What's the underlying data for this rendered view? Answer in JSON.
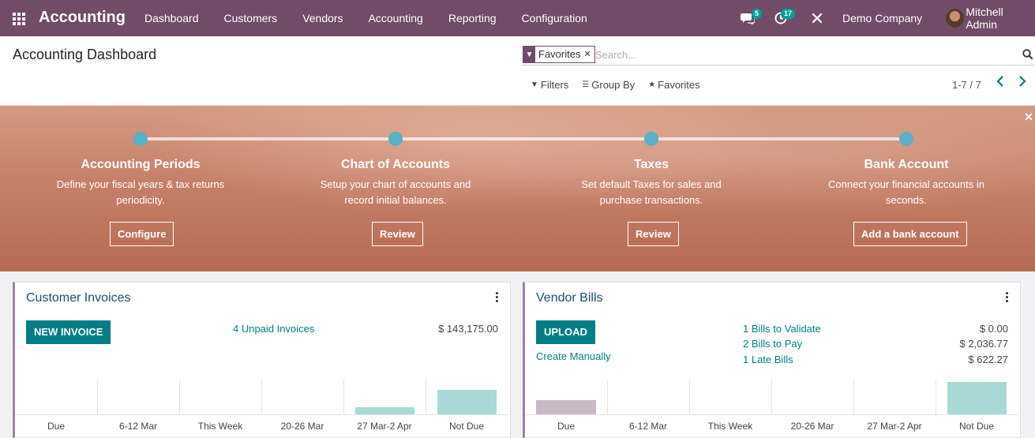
{
  "navbar": {
    "brand": "Accounting",
    "menu": [
      "Dashboard",
      "Customers",
      "Vendors",
      "Accounting",
      "Reporting",
      "Configuration"
    ],
    "messages_count": "5",
    "activities_count": "17",
    "company": "Demo Company",
    "user": "Mitchell Admin",
    "color": "#714b67"
  },
  "control_panel": {
    "title": "Accounting Dashboard",
    "facet_label": "Favorites",
    "search_placeholder": "Search...",
    "filters_label": "Filters",
    "groupby_label": "Group By",
    "favorites_label": "Favorites",
    "pager": "1-7 / 7"
  },
  "onboarding": {
    "steps": [
      {
        "title": "Accounting Periods",
        "desc1": "Define your fiscal years & tax returns",
        "desc2": "periodicity.",
        "button": "Configure"
      },
      {
        "title": "Chart of Accounts",
        "desc1": "Setup your chart of accounts and",
        "desc2": "record initial balances.",
        "button": "Review"
      },
      {
        "title": "Taxes",
        "desc1": "Set default Taxes for sales and",
        "desc2": "purchase transactions.",
        "button": "Review"
      },
      {
        "title": "Bank Account",
        "desc1": "Connect your financial accounts in",
        "desc2": "seconds.",
        "button": "Add a bank account"
      }
    ]
  },
  "customer_invoices": {
    "title": "Customer Invoices",
    "button": "NEW INVOICE",
    "unpaid_link": "4 Unpaid Invoices",
    "unpaid_amount": "$ 143,175.00",
    "graph_labels": [
      "Due",
      "6-12 Mar",
      "This Week",
      "20-26 Mar",
      "27 Mar-2 Apr",
      "Not Due"
    ],
    "graph_values": [
      0,
      0,
      0,
      0,
      0.22,
      0.7
    ],
    "bar_color": "#a8d9d6"
  },
  "vendor_bills": {
    "title": "Vendor Bills",
    "button": "UPLOAD",
    "create_manually": "Create Manually",
    "rows": [
      {
        "label": "1 Bills to Validate",
        "amount": "$ 0.00"
      },
      {
        "label": "2 Bills to Pay",
        "amount": "$ 2,036.77"
      },
      {
        "label": "1 Late Bills",
        "amount": "$ 622.27"
      }
    ],
    "graph_labels": [
      "Due",
      "6-12 Mar",
      "This Week",
      "20-26 Mar",
      "27 Mar-2 Apr",
      "Not Due"
    ],
    "graph_values": [
      0.42,
      0,
      0,
      0,
      0,
      0.92
    ],
    "bar_colors": [
      "#cbb9c7",
      "#a8d9d6",
      "#a8d9d6",
      "#a8d9d6",
      "#a8d9d6",
      "#a8d9d6"
    ]
  }
}
